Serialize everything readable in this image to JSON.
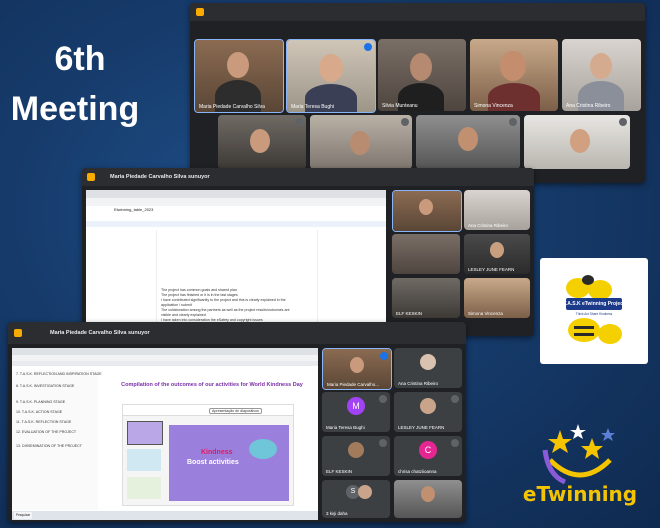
{
  "meeting_title": {
    "line1": "6th",
    "line2": "Meeting"
  },
  "window_top": {
    "participants": [
      "Maria Piedade Carvalho Silva",
      "Maria Teresa Bughi",
      "Silvia Munteanu",
      "Simona Vincenza",
      "Ana Cristina Ribeiro"
    ]
  },
  "window_middle": {
    "presenter_label": "Maria Piedade Carvalho Silva sunuyor",
    "doc_tab": "Etwinning_table_2023",
    "doc_lines": [
      "The project has common goals and shared plan",
      "The project has finished or it is in the last stages",
      "I have contributed significantly to the project and this is clearly explained in the",
      "application / submit",
      "The collaboration among the partners as well as the project results/outcomes are",
      "visible and clearly explained",
      "I have taken into consideration the eSafety and copyright issues",
      "Please make sure that all content added to eTwinning that requires licence will be",
      "allowing this content"
    ],
    "side_participants": [
      "Ana Cristina Ribeiro",
      "LESLEY JUNE FEARN",
      "ELF KESKIN",
      "Simona Vincenza"
    ]
  },
  "window_front": {
    "presenter_label": "Maria Piedade Carvalho Silva sunuyor",
    "sidebar_items": [
      "7. T.A.S.K. REFLECTION AND INSPIRATION STAGE",
      "8. T.A.S.K. INVESTIGATION STAGE",
      "9. T.A.S.K. PLANNING STAGE",
      "10. T.A.S.K. ACTION STAGE",
      "11. T.A.S.K. REFLECTION STAGE",
      "12. EVALUATION OF THE PROJECT",
      "13. DISSEMINATION OF THE PROJECT"
    ],
    "page_heading": "Compilation of the outcomes of our activities for World Kindness Day",
    "slide_mode": "Apresentação de diapositivos",
    "slide_title_1": "Kindness",
    "slide_title_2": "Boost activities",
    "participants": [
      "Maria Piedade Carvalho...",
      "Ana Cristina Ribeiro",
      "Maria Teresa Bughi",
      "LESLEY JUNE FEARN",
      "ELF KESKIN",
      "chrisa chatziioanna",
      "3 kişi daha"
    ],
    "avatar_letters": {
      "maria_teresa": "M",
      "chrisa": "C",
      "more": "S"
    },
    "taskbar_search": "Pesquisar",
    "colors": {
      "avatar_m": "#a142f4",
      "avatar_c": "#e52592",
      "avatar_s": "#5f6368"
    }
  },
  "task_logo": {
    "title": "T.A.S.K eTwinning Project",
    "subtitle": "Think Act Share Kindness"
  },
  "etwinning_logo": {
    "text": "eTwinning"
  }
}
